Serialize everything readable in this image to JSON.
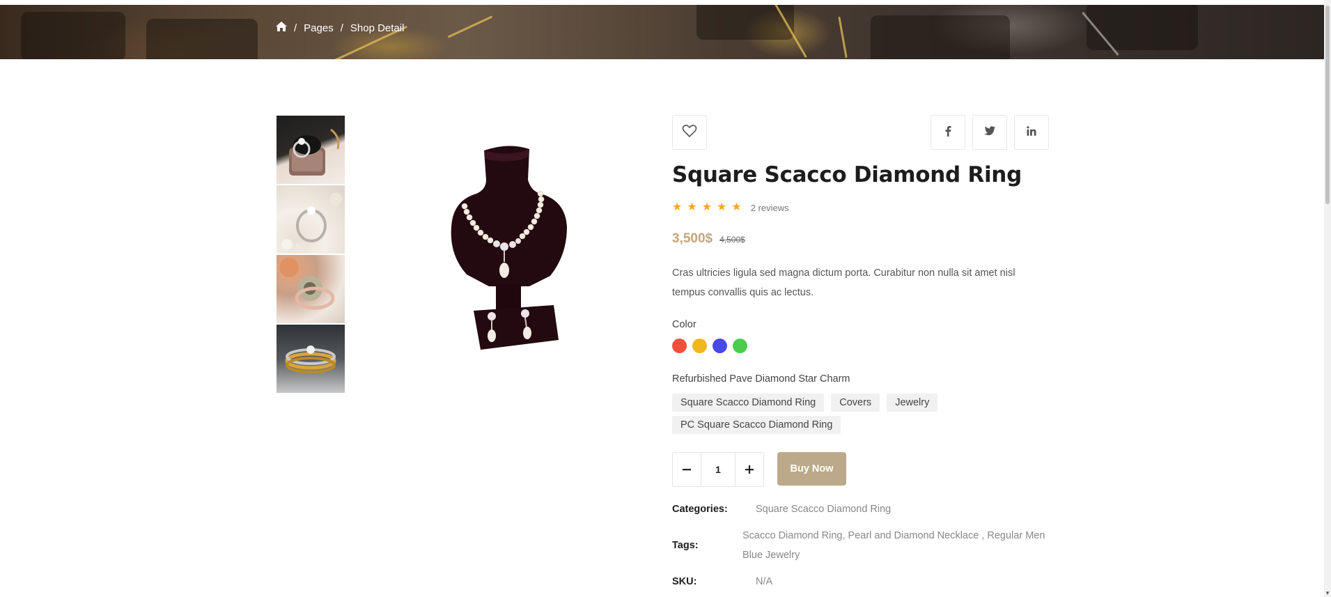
{
  "breadcrumb": {
    "home_icon": "home-icon",
    "items": [
      "Pages",
      "Shop Detail"
    ]
  },
  "gallery": {
    "thumbnails": [
      "ring-in-box",
      "ring-on-pearls",
      "floral-ring",
      "gold-ring-stack"
    ],
    "main_image": "pearl-necklace-on-bust"
  },
  "actions": {
    "wishlist_icon": "heart-icon",
    "share_icons": [
      "facebook-icon",
      "twitter-icon",
      "linkedin-icon"
    ]
  },
  "product": {
    "title": "Square Scacco Diamond Ring",
    "rating": 5,
    "reviews": "2 reviews",
    "price": "3,500$",
    "old_price": "4,500$",
    "description": "Cras ultricies ligula sed magna dictum porta. Curabitur non nulla sit amet nisl tempus convallis quis ac lectus.",
    "color_label": "Color",
    "colors": [
      "#f0503c",
      "#f0b81c",
      "#4848e8",
      "#4ccc4c"
    ],
    "variant_label": "Refurbished Pave Diamond Star Charm",
    "variants": [
      "Square Scacco Diamond Ring",
      "Covers",
      "Jewelry",
      "PC Square Scacco Diamond Ring"
    ],
    "quantity": "1",
    "buy_label": "Buy Now"
  },
  "meta": {
    "categories_label": "Categories:",
    "categories_value": "Square Scacco Diamond Ring",
    "tags_label": "Tags:",
    "tags_value": "Scacco Diamond Ring, Pearl and Diamond Necklace , Regular Men Blue Jewelry",
    "sku_label": "SKU:",
    "sku_value": "N/A"
  }
}
